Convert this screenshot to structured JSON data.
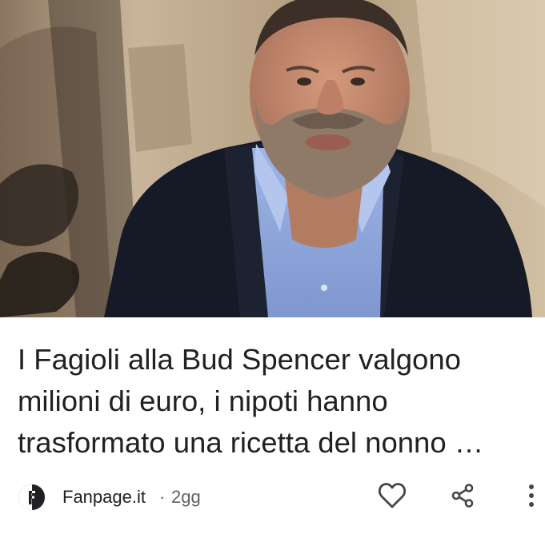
{
  "article": {
    "headline": "I Fagioli alla Bud Spencer valgono milioni di euro, i nipoti hanno trasformato una ricetta del nonno …",
    "source": {
      "name": "Fanpage.it",
      "separator": "·",
      "age": "2gg",
      "logo_icon": "fanpage-logo-icon"
    },
    "image": {
      "icon": "article-photo",
      "colors": {
        "background": "#b8a489",
        "jacket": "#161a26",
        "shirt": "#8ea6db",
        "skin": "#c08a6e",
        "beard": "#8f7a6a"
      }
    },
    "actions": {
      "like_icon": "heart-icon",
      "share_icon": "share-icon",
      "more_icon": "more-vert-icon"
    }
  },
  "colors": {
    "text_primary": "#202124",
    "text_secondary": "#5f6368",
    "icon": "#444746"
  }
}
